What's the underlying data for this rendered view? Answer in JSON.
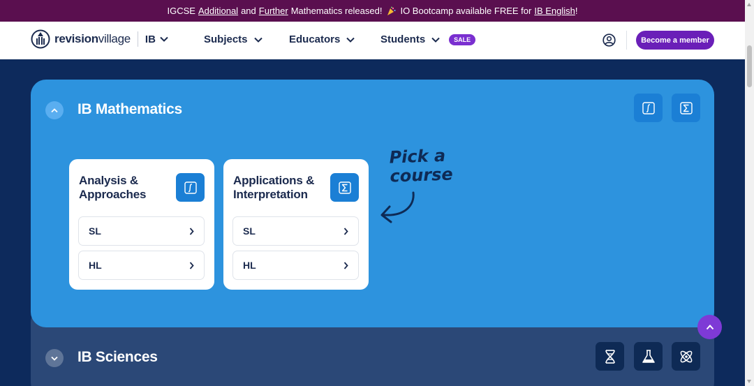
{
  "announcement": {
    "prefix": "IGCSE",
    "link_additional": "Additional",
    "and": "and",
    "link_further": "Further",
    "middle": "Mathematics released!",
    "bootcamp": "IO Bootcamp available FREE for",
    "link_english": "IB English",
    "suffix": "!"
  },
  "nav": {
    "logo_bold": "revision",
    "logo_thin": "village",
    "curriculum": "IB",
    "menu": [
      {
        "label": "Subjects"
      },
      {
        "label": "Educators"
      },
      {
        "label": "Students"
      }
    ],
    "sale_badge": "SALE",
    "member_button": "Become a member"
  },
  "math_section": {
    "title": "IB Mathematics",
    "courses": [
      {
        "title_line1": "Analysis &",
        "title_line2": "Approaches",
        "icon": "integral-icon",
        "levels": [
          "SL",
          "HL"
        ]
      },
      {
        "title_line1": "Applications &",
        "title_line2": "Interpretation",
        "icon": "sigma-icon",
        "levels": [
          "SL",
          "HL"
        ]
      }
    ],
    "hint_line1": "Pick a",
    "hint_line2": "course"
  },
  "sciences_section": {
    "title": "IB Sciences",
    "icons": [
      "dna-icon",
      "flask-icon",
      "atom-icon"
    ]
  },
  "colors": {
    "announcement_bg": "#5a0f4f",
    "page_bg": "#0d2a5c",
    "math_panel": "#2d93de",
    "sciences_panel": "#2b4877",
    "member_button": "#6a1fb8",
    "sale_badge": "#7a2fd0"
  }
}
